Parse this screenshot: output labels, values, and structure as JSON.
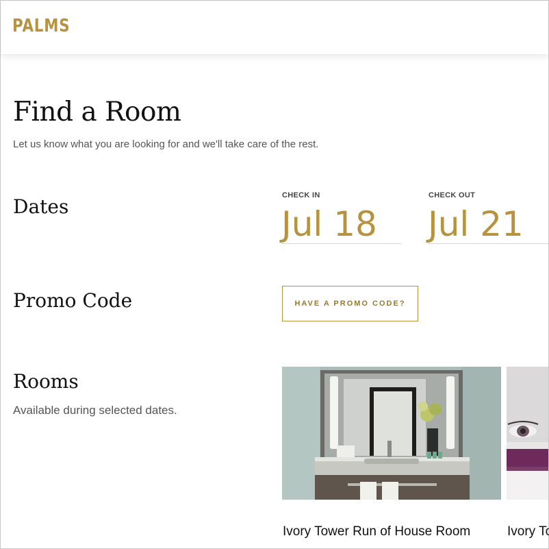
{
  "header": {
    "logo": "PALMS"
  },
  "page": {
    "title": "Find a Room",
    "subtitle": "Let us know what you are looking for and we'll take care of the rest."
  },
  "dates": {
    "label": "Dates",
    "check_in_label": "CHECK IN",
    "check_in_value": "Jul 18",
    "check_out_label": "CHECK OUT",
    "check_out_value": "Jul 21"
  },
  "promo": {
    "label": "Promo Code",
    "button_label": "HAVE A PROMO CODE?"
  },
  "rooms": {
    "label": "Rooms",
    "subtitle": "Available during selected dates.",
    "items": [
      {
        "name": "Ivory Tower Run of House Room"
      },
      {
        "name": "Ivory To"
      }
    ]
  },
  "colors": {
    "accent": "#b8933f"
  }
}
